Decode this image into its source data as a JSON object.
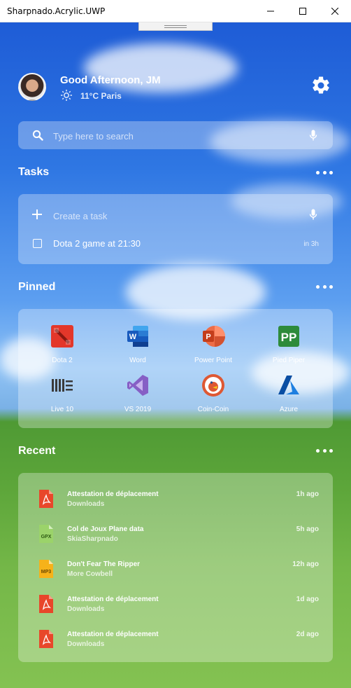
{
  "window": {
    "title": "Sharpnado.Acrylic.UWP"
  },
  "header": {
    "greeting": "Good Afternoon, JM",
    "weather": "11°C  Paris"
  },
  "search": {
    "placeholder": "Type here to search"
  },
  "tasks": {
    "title": "Tasks",
    "create_placeholder": "Create a task",
    "items": [
      {
        "text": "Dota 2 game at 21:30",
        "due": "in 3h"
      }
    ]
  },
  "pinned": {
    "title": "Pinned",
    "apps": [
      {
        "label": "Dota 2",
        "icon": "dota2-icon"
      },
      {
        "label": "Word",
        "icon": "word-icon"
      },
      {
        "label": "Power Point",
        "icon": "powerpoint-icon"
      },
      {
        "label": "Pied Piper",
        "icon": "pied-piper-icon"
      },
      {
        "label": "Live 10",
        "icon": "live10-icon"
      },
      {
        "label": "VS 2019",
        "icon": "visual-studio-icon"
      },
      {
        "label": "Coin-Coin",
        "icon": "duckduckgo-icon"
      },
      {
        "label": "Azure",
        "icon": "azure-icon"
      }
    ]
  },
  "recent": {
    "title": "Recent",
    "items": [
      {
        "name": "Attestation de déplacement",
        "location": "Downloads",
        "time": "1h ago",
        "type": "pdf"
      },
      {
        "name": "Col de Joux Plane data",
        "location": "SkiaSharpnado",
        "time": "5h ago",
        "type": "GPX"
      },
      {
        "name": "Don't Fear The Ripper",
        "location": "More Cowbell",
        "time": "12h ago",
        "type": "MP3"
      },
      {
        "name": "Attestation de déplacement",
        "location": "Downloads",
        "time": "1d ago",
        "type": "pdf"
      },
      {
        "name": "Attestation de déplacement",
        "location": "Downloads",
        "time": "2d ago",
        "type": "pdf"
      }
    ]
  },
  "colors": {
    "pdf": "#e8472a",
    "gpx": "#7cc04a",
    "mp3": "#f6b21a",
    "office_word": "#2b579a",
    "office_ppt": "#d24726"
  }
}
